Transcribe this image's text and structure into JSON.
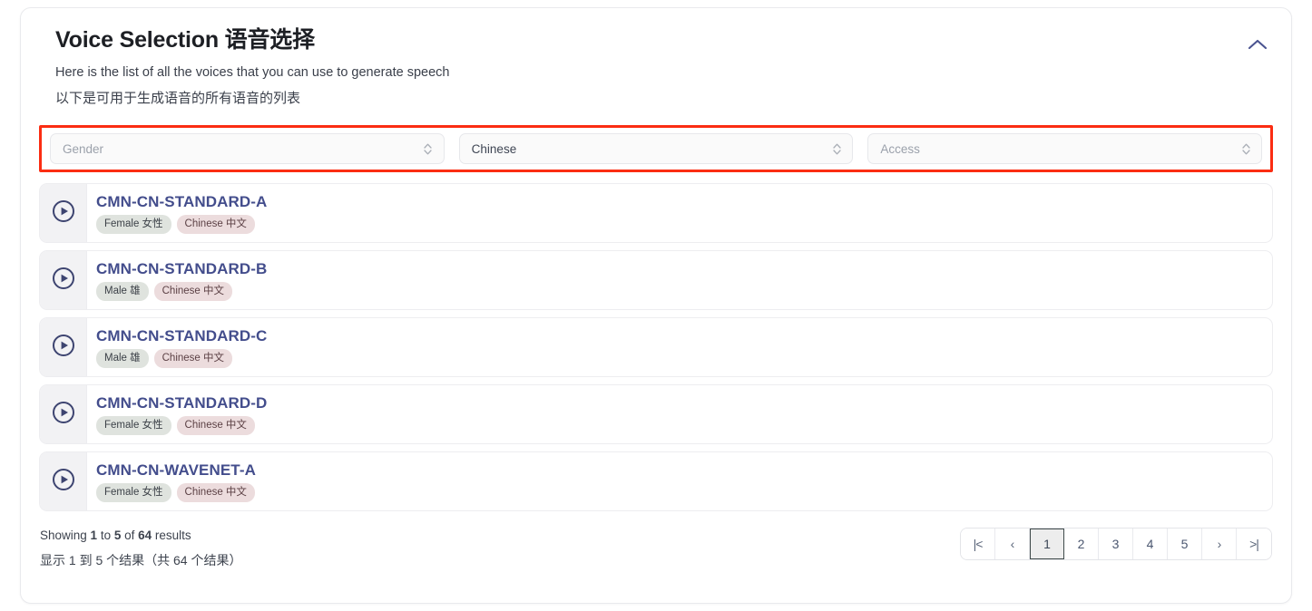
{
  "card": {
    "title": "Voice Selection 语音选择",
    "subtitle_en": "Here is the list of all the voices that you can use to generate speech",
    "subtitle_zh": "以下是可用于生成语音的所有语音的列表",
    "collapse_icon": "chevron-up-icon",
    "accent_color": "#434d8c",
    "highlight_color": "#fb2d12"
  },
  "filters": [
    {
      "name": "gender",
      "value": "Gender",
      "is_placeholder": true
    },
    {
      "name": "language",
      "value": "Chinese",
      "is_placeholder": false
    },
    {
      "name": "access",
      "value": "Access",
      "is_placeholder": true
    }
  ],
  "voices": [
    {
      "name": "CMN-CN-STANDARD-A",
      "play_icon": "play-circle-icon",
      "gender_badge": "Female 女性",
      "language_badge": "Chinese 中文"
    },
    {
      "name": "CMN-CN-STANDARD-B",
      "play_icon": "play-circle-icon",
      "gender_badge": "Male 雄",
      "language_badge": "Chinese 中文"
    },
    {
      "name": "CMN-CN-STANDARD-C",
      "play_icon": "play-circle-icon",
      "gender_badge": "Male 雄",
      "language_badge": "Chinese 中文"
    },
    {
      "name": "CMN-CN-STANDARD-D",
      "play_icon": "play-circle-icon",
      "gender_badge": "Female 女性",
      "language_badge": "Chinese 中文"
    },
    {
      "name": "CMN-CN-WAVENET-A",
      "play_icon": "play-circle-icon",
      "gender_badge": "Female 女性",
      "language_badge": "Chinese 中文"
    }
  ],
  "footer": {
    "results_en_prefix": "Showing ",
    "results_from": "1",
    "results_mid1": " to ",
    "results_to": "5",
    "results_mid2": " of ",
    "results_total": "64",
    "results_en_suffix": " results",
    "results_zh": "显示 1 到 5 个结果（共 64 个结果）"
  },
  "pagination": {
    "first_label": "|<",
    "prev_label": "‹",
    "next_label": "›",
    "last_label": ">|",
    "pages": [
      "1",
      "2",
      "3",
      "4",
      "5"
    ],
    "active_page": "1"
  }
}
